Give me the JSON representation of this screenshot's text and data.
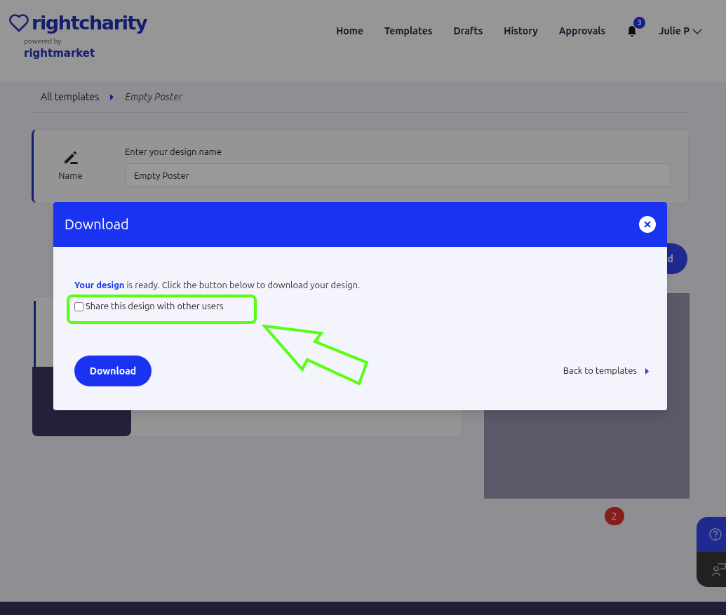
{
  "header": {
    "logo": "rightcharity",
    "powered_by": "powered by",
    "sub_logo": "rightmarket",
    "nav": [
      {
        "label": "Home"
      },
      {
        "label": "Templates"
      },
      {
        "label": "Drafts"
      },
      {
        "label": "History"
      },
      {
        "label": "Approvals"
      }
    ],
    "notifications": "3",
    "user": "Julie P"
  },
  "breadcrumb": [
    {
      "label": "All templates",
      "italic": false
    },
    {
      "label": "Empty Poster",
      "italic": true
    }
  ],
  "name_card": {
    "label": "Name",
    "field_label": "Enter your design name",
    "value": "Empty Poster"
  },
  "background_button": {
    "label": "d"
  },
  "page_badge": "2",
  "modal": {
    "title": "Download",
    "message": "**Your design** is ready. Click the button below to download your design.",
    "share": {
      "label": "Share this design with other users",
      "checked": false
    },
    "download_button": "Download",
    "back_link": "Back to templates"
  }
}
